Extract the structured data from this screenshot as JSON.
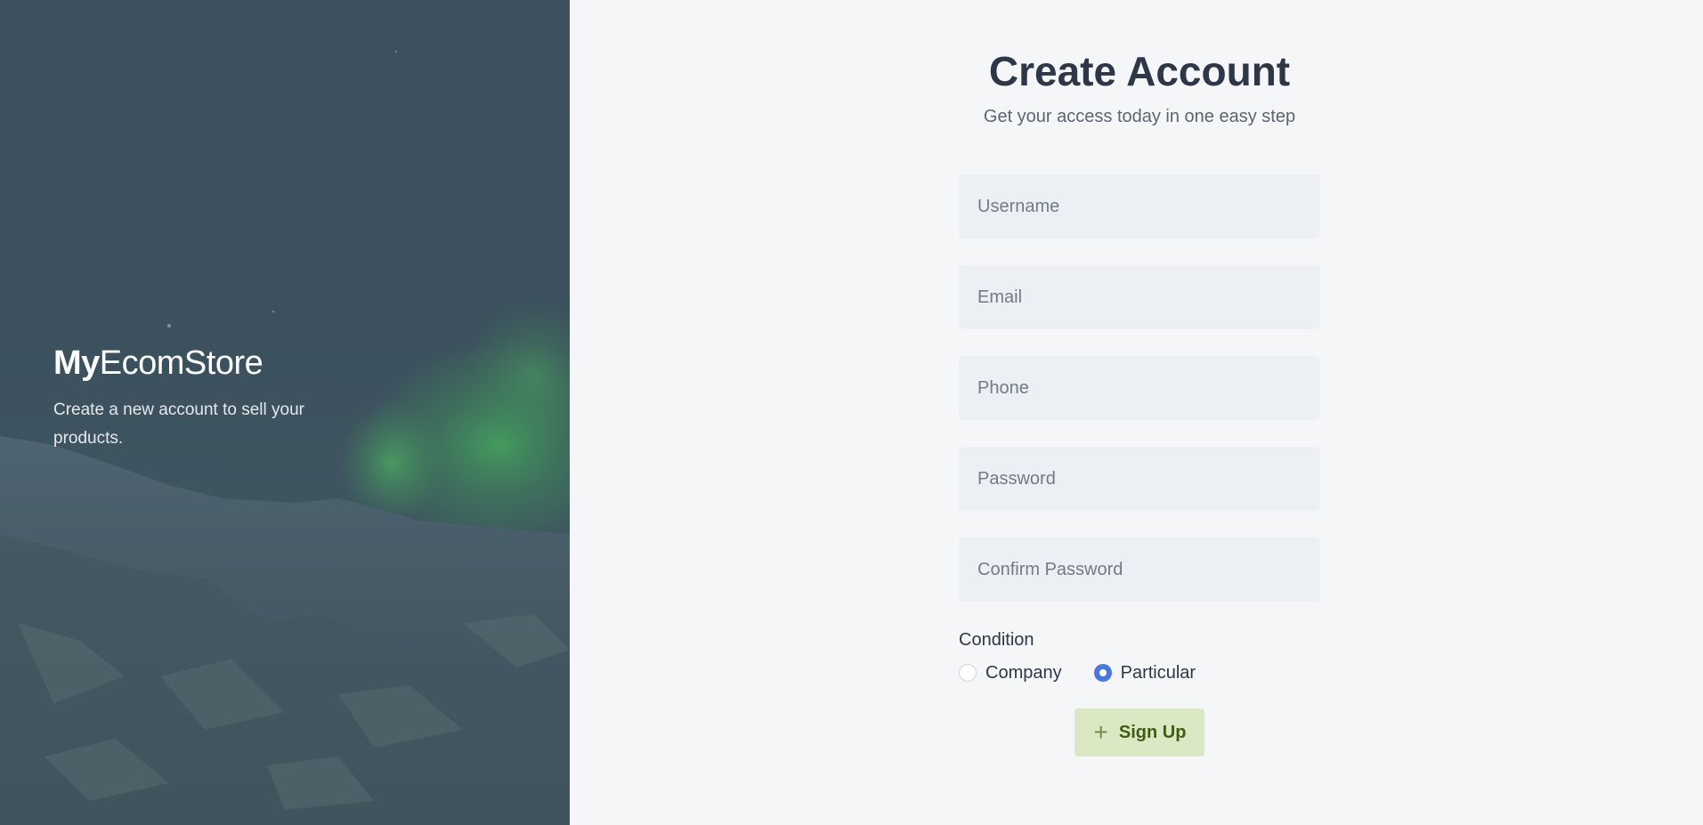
{
  "hero": {
    "brand_strong": "My",
    "brand_light": "EcomStore",
    "tagline": "Create a new account to sell your products."
  },
  "form": {
    "title": "Create Account",
    "subtitle": "Get your access today in one easy step",
    "fields": {
      "username": {
        "placeholder": "Username",
        "value": ""
      },
      "email": {
        "placeholder": "Email",
        "value": ""
      },
      "phone": {
        "placeholder": "Phone",
        "value": ""
      },
      "password": {
        "placeholder": "Password",
        "value": ""
      },
      "confirm_password": {
        "placeholder": "Confirm Password",
        "value": ""
      }
    },
    "condition": {
      "label": "Condition",
      "options": [
        {
          "label": "Company",
          "selected": false
        },
        {
          "label": "Particular",
          "selected": true
        }
      ]
    },
    "submit": {
      "label": "Sign Up",
      "icon": "plus-icon"
    }
  },
  "colors": {
    "title": "#2d3748",
    "radio_selected": "#4c78dd",
    "button_bg": "#dbe8c4",
    "button_text": "#3d5e12",
    "hero_bg": "#3e4f5d",
    "aurora": "#3f8f5a"
  }
}
